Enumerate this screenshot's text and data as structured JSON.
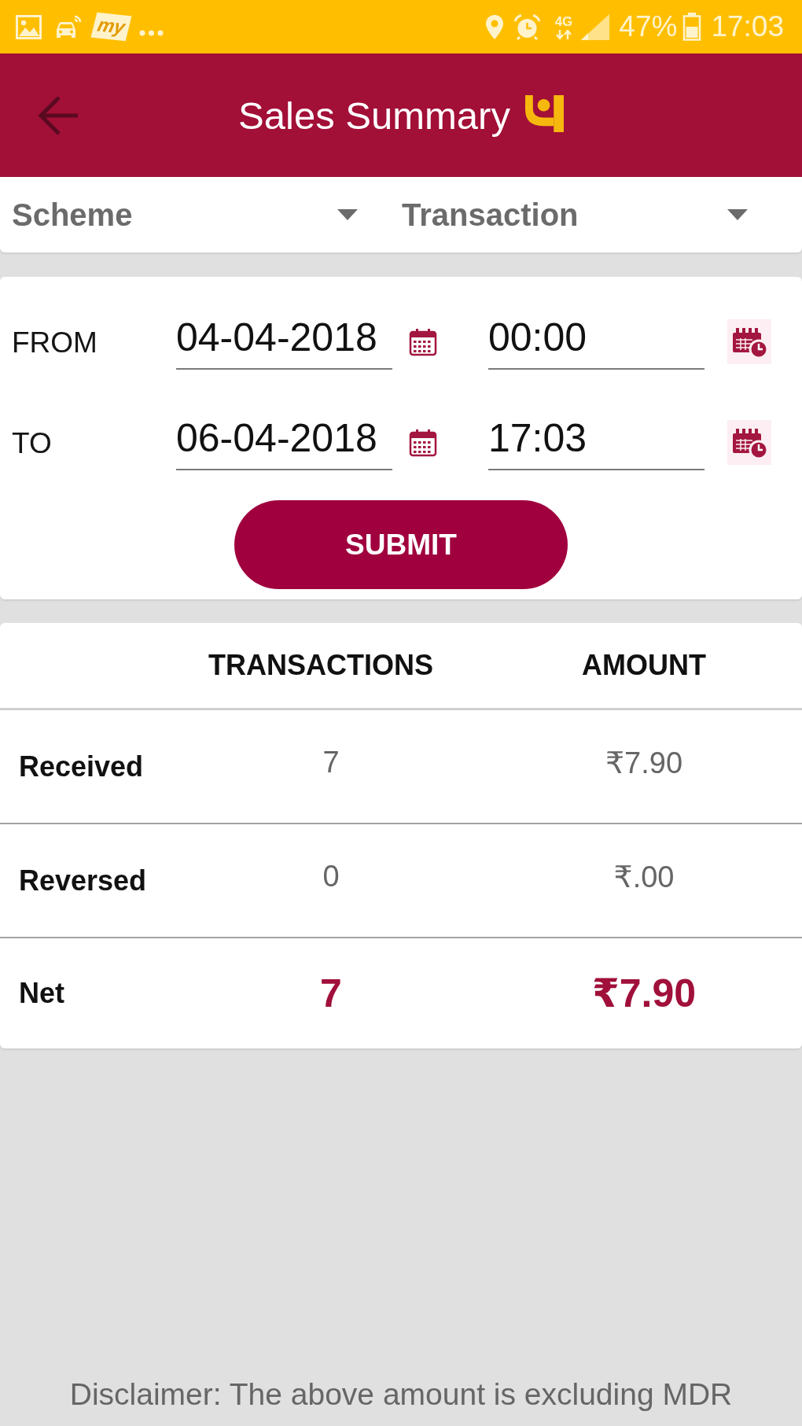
{
  "status_bar": {
    "notification_tag": "my",
    "network_type": "4G",
    "battery": "47%",
    "time": "17:03"
  },
  "header": {
    "title": "Sales Summary"
  },
  "filters": [
    {
      "label": "Scheme"
    },
    {
      "label": "Transaction"
    }
  ],
  "date_range": [
    {
      "label": "FROM",
      "date": "04-04-2018",
      "time": "00:00"
    },
    {
      "label": "TO",
      "date": "06-04-2018",
      "time": "17:03"
    }
  ],
  "submit_button": "SUBMIT",
  "summary_table": {
    "columns": [
      {
        "label": "TRANSACTIONS"
      },
      {
        "label": "AMOUNT"
      }
    ],
    "rows": [
      {
        "kind": "detail",
        "label": "Received",
        "transactions": "7",
        "amount": "₹7.90"
      },
      {
        "kind": "detail",
        "label": "Reversed",
        "transactions": "0",
        "amount": "₹.00"
      },
      {
        "kind": "total",
        "label": "Net",
        "transactions": "7",
        "amount": "₹7.90"
      }
    ]
  },
  "disclaimer": "Disclaimer: The above amount is excluding MDR"
}
